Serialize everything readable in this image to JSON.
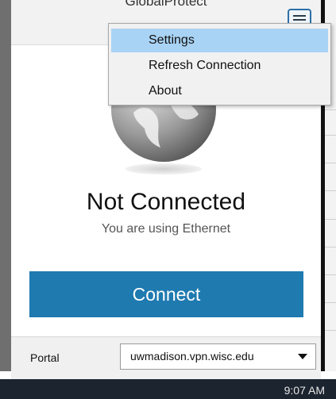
{
  "window": {
    "title": "GlobalProtect"
  },
  "menu": {
    "items": [
      {
        "label": "Settings",
        "highlighted": true
      },
      {
        "label": "Refresh Connection",
        "highlighted": false
      },
      {
        "label": "About",
        "highlighted": false
      }
    ]
  },
  "status": {
    "title": "Not Connected",
    "subtitle": "You are using Ethernet"
  },
  "connect_button": {
    "label": "Connect"
  },
  "footer": {
    "portal_label": "Portal",
    "portal_value": "uwmadison.vpn.wisc.edu"
  },
  "taskbar": {
    "clock": "9:07 AM"
  },
  "colors": {
    "accent": "#1f7ab0",
    "menu_highlight": "#a9d3f4"
  },
  "icons": {
    "menu": "hamburger-icon",
    "globe": "globe-icon",
    "dropdown": "chevron-down-icon"
  }
}
